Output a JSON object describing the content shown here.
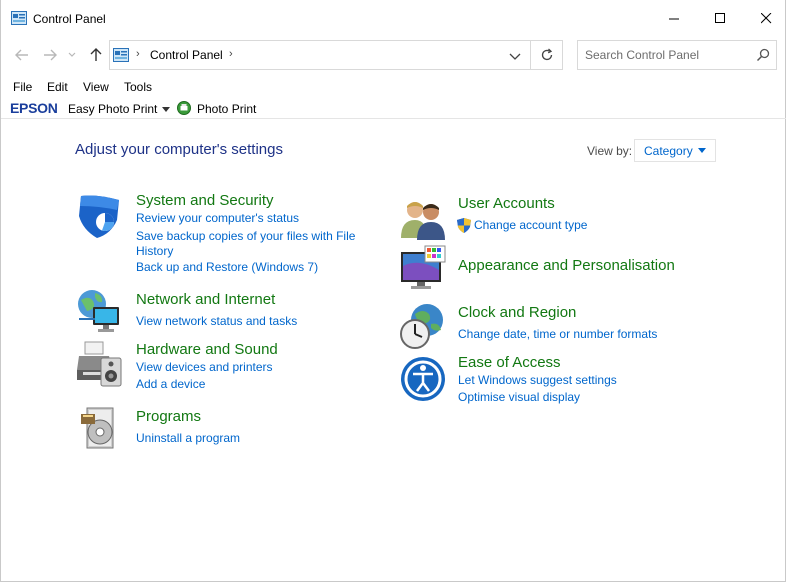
{
  "window": {
    "title": "Control Panel",
    "icon": "control-panel-icon"
  },
  "address": {
    "path": "Control Panel",
    "search_placeholder": "Search Control Panel"
  },
  "menu": {
    "items": [
      "File",
      "Edit",
      "View",
      "Tools"
    ]
  },
  "toolbar": {
    "brand": "EPSON",
    "easy_photo_print": "Easy Photo Print",
    "photo_print": "Photo Print"
  },
  "main": {
    "heading": "Adjust your computer's settings",
    "view_by_label": "View by:",
    "view_by_value": "Category"
  },
  "categories": [
    {
      "title": "System and Security",
      "icon": "shield-icon",
      "links": [
        "Review your computer's status",
        "Save backup copies of your files with File",
        "History",
        "Back up and Restore (Windows 7)"
      ]
    },
    {
      "title": "Network and Internet",
      "icon": "globe-network-icon",
      "links": [
        "View network status and tasks"
      ]
    },
    {
      "title": "Hardware and Sound",
      "icon": "printer-speaker-icon",
      "links": [
        "View devices and printers",
        "Add a device"
      ]
    },
    {
      "title": "Programs",
      "icon": "programs-disc-icon",
      "links": [
        "Uninstall a program"
      ]
    },
    {
      "title": "User Accounts",
      "icon": "users-icon",
      "links": [
        "Change account type"
      ]
    },
    {
      "title": "Appearance and Personalisation",
      "icon": "monitor-palette-icon",
      "links": []
    },
    {
      "title": "Clock and Region",
      "icon": "clock-globe-icon",
      "links": [
        "Change date, time or number formats"
      ]
    },
    {
      "title": "Ease of Access",
      "icon": "ease-of-access-icon",
      "links": [
        "Let Windows suggest settings",
        "Optimise visual display"
      ]
    }
  ],
  "colors": {
    "heading": "#1e3287",
    "category_title": "#127812",
    "link": "#0066cc",
    "epson_brand": "#1a3e9c"
  }
}
